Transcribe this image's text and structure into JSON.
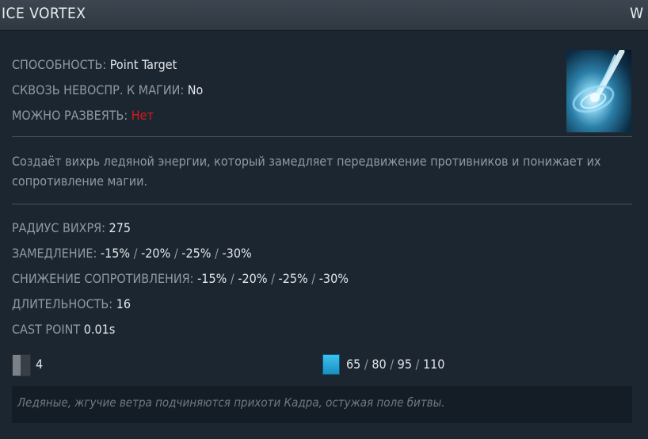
{
  "ability": {
    "name": "ICE VORTEX",
    "hotkey": "W"
  },
  "properties": [
    {
      "label": "СПОСОБНОСТЬ:",
      "value": "Point Target",
      "color": "#e2e6ea"
    },
    {
      "label": "СКВОЗЬ НЕВОСПР. К МАГИИ:",
      "value": "No",
      "color": "#e2e6ea"
    },
    {
      "label": "МОЖНО РАЗВЕЯТЬ:",
      "value": "Нет",
      "color": "#d81c1c"
    }
  ],
  "icon": "ice-vortex-icon",
  "description": "Создаёт вихрь ледяной энергии, который замедляет передвижение противников и понижает их сопротивление магии.",
  "stats": {
    "radius": {
      "label": "РАДИУС ВИХРЯ:",
      "value": "275"
    },
    "slow": {
      "label": "ЗАМЕДЛЕНИЕ:",
      "values": [
        "-15%",
        "-20%",
        "-25%",
        "-30%"
      ]
    },
    "resist": {
      "label": "СНИЖЕНИЕ СОПРОТИВЛЕНИЯ:",
      "values": [
        "-15%",
        "-20%",
        "-25%",
        "-30%"
      ]
    },
    "duration": {
      "label": "ДЛИТЕЛЬНОСТЬ:",
      "value": "16"
    },
    "cast_point": {
      "label": "CAST POINT",
      "value": "0.01s"
    }
  },
  "cooldown": {
    "icon": "cooldown-icon",
    "value": "4"
  },
  "mana": {
    "icon": "mana-icon",
    "values": [
      "65",
      "80",
      "95",
      "110"
    ]
  },
  "lore": "Ледяные, жгучие ветра подчиняются прихоти Кадра, остужая поле битвы."
}
